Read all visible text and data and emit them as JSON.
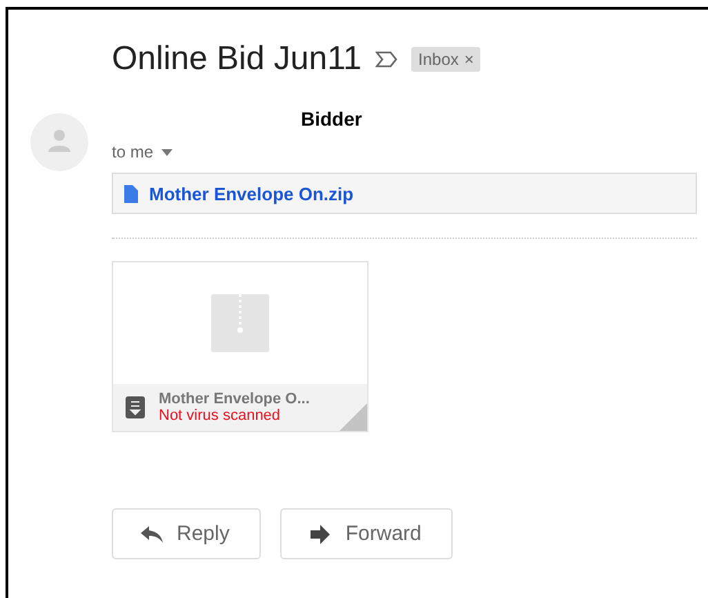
{
  "subject": "Online Bid Jun11",
  "label": {
    "text": "Inbox",
    "remove": "×"
  },
  "sender": "Bidder",
  "recipient": "to me",
  "attachment_link": "Mother Envelope On.zip",
  "attachment_card": {
    "name": "Mother Envelope O...",
    "status": "Not virus scanned"
  },
  "buttons": [
    {
      "kind": "reply",
      "label": "Reply"
    },
    {
      "kind": "forward",
      "label": "Forward"
    }
  ]
}
